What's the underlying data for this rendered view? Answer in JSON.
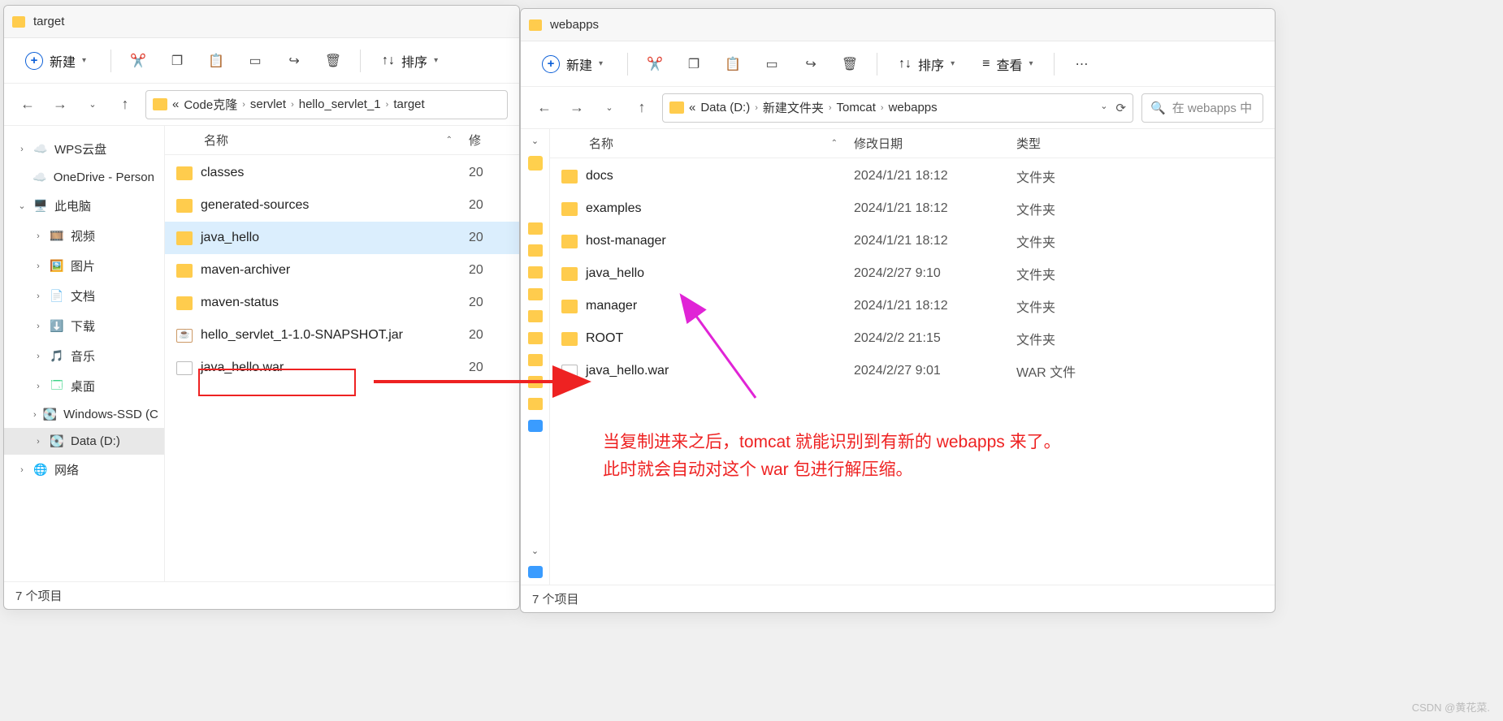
{
  "left_window": {
    "title": "target",
    "toolbar": {
      "new": "新建",
      "sort": "排序"
    },
    "breadcrumbs": [
      "Code克隆",
      "servlet",
      "hello_servlet_1",
      "target"
    ],
    "breadcrumb_prefix": "«",
    "columns": {
      "name": "名称",
      "date": "修"
    },
    "sidebar": [
      {
        "label": "WPS云盘",
        "icon": "☁️",
        "chev": "›",
        "color": "#ff8a3c"
      },
      {
        "label": "OneDrive - Person",
        "icon": "☁️",
        "chev": "",
        "color": "#1a6fe0"
      },
      {
        "label": "此电脑",
        "icon": "🖥️",
        "chev": "⌄",
        "bold": true
      },
      {
        "label": "视频",
        "icon": "🎞️",
        "chev": "›",
        "indent": true
      },
      {
        "label": "图片",
        "icon": "🖼️",
        "chev": "›",
        "indent": true
      },
      {
        "label": "文档",
        "icon": "📄",
        "chev": "›",
        "indent": true
      },
      {
        "label": "下载",
        "icon": "⬇️",
        "chev": "›",
        "indent": true
      },
      {
        "label": "音乐",
        "icon": "🎵",
        "chev": "›",
        "indent": true
      },
      {
        "label": "桌面",
        "icon": "🗔",
        "chev": "›",
        "indent": true
      },
      {
        "label": "Windows-SSD (C",
        "icon": "💽",
        "chev": "›",
        "indent": true
      },
      {
        "label": "Data (D:)",
        "icon": "💽",
        "chev": "›",
        "indent": true,
        "selected": true
      },
      {
        "label": "网络",
        "icon": "🌐",
        "chev": "›"
      }
    ],
    "files": [
      {
        "name": "classes",
        "type": "folder",
        "date": "20"
      },
      {
        "name": "generated-sources",
        "type": "folder",
        "date": "20"
      },
      {
        "name": "java_hello",
        "type": "folder",
        "date": "20",
        "selected": true
      },
      {
        "name": "maven-archiver",
        "type": "folder",
        "date": "20"
      },
      {
        "name": "maven-status",
        "type": "folder",
        "date": "20"
      },
      {
        "name": "hello_servlet_1-1.0-SNAPSHOT.jar",
        "type": "jar",
        "date": "20"
      },
      {
        "name": "java_hello.war",
        "type": "file",
        "date": "20"
      }
    ],
    "status": "7 个项目"
  },
  "right_window": {
    "title": "webapps",
    "toolbar": {
      "new": "新建",
      "sort": "排序",
      "view": "查看"
    },
    "breadcrumbs": [
      "Data (D:)",
      "新建文件夹",
      "Tomcat",
      "webapps"
    ],
    "breadcrumb_prefix": "«",
    "search_placeholder": "在 webapps 中",
    "columns": {
      "name": "名称",
      "date": "修改日期",
      "type": "类型"
    },
    "files": [
      {
        "name": "docs",
        "type": "folder",
        "date": "2024/1/21 18:12",
        "ft": "文件夹"
      },
      {
        "name": "examples",
        "type": "folder",
        "date": "2024/1/21 18:12",
        "ft": "文件夹"
      },
      {
        "name": "host-manager",
        "type": "folder",
        "date": "2024/1/21 18:12",
        "ft": "文件夹"
      },
      {
        "name": "java_hello",
        "type": "folder",
        "date": "2024/2/27 9:10",
        "ft": "文件夹"
      },
      {
        "name": "manager",
        "type": "folder",
        "date": "2024/1/21 18:12",
        "ft": "文件夹"
      },
      {
        "name": "ROOT",
        "type": "folder",
        "date": "2024/2/2 21:15",
        "ft": "文件夹"
      },
      {
        "name": "java_hello.war",
        "type": "file",
        "date": "2024/2/27 9:01",
        "ft": "WAR 文件"
      }
    ],
    "status": "7 个项目"
  },
  "annotations": {
    "line1": "当复制进来之后，tomcat 就能识别到有新的 webapps 来了。",
    "line2": "此时就会自动对这个 war 包进行解压缩。"
  },
  "watermark": "CSDN @黄花菜."
}
